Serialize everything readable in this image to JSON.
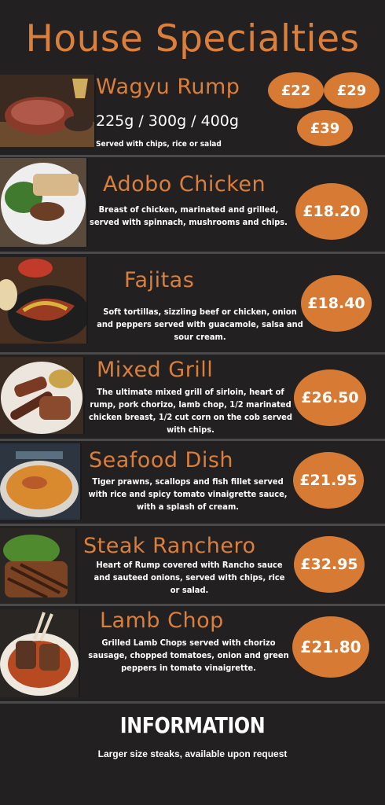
{
  "title": "House Specialties",
  "dishes": [
    {
      "name": "Wagyu Rump",
      "sizes": "225g  / 300g  / 400g",
      "description": "Served with chips, rice or salad",
      "prices": [
        "£22",
        "£29",
        "£39"
      ]
    },
    {
      "name": "Adobo Chicken",
      "description": "Breast of chicken, marinated and grilled, served with spinnach, mushrooms and chips.",
      "price": "£18.20"
    },
    {
      "name": "Fajitas",
      "description": "Soft tortillas, sizzling beef or chicken, onion and peppers served with guacamole, salsa and sour cream.",
      "price": "£18.40"
    },
    {
      "name": "Mixed Grill",
      "description": "The ultimate mixed grill of sirloin, heart of rump, pork chorizo, lamb chop, 1/2 marinated chicken breast, 1/2 cut corn on the cob served with chips.",
      "price": "£26.50"
    },
    {
      "name": "Seafood Dish",
      "description": "Tiger prawns, scallops and fish fillet served with rice and spicy tomato vinaigrette sauce, with a splash of cream.",
      "price": "£21.95"
    },
    {
      "name": "Steak Ranchero",
      "description": "Heart of Rump covered with Rancho sauce and sauteed onions, served with chips, rice or salad.",
      "price": "£32.95"
    },
    {
      "name": "Lamb Chop",
      "description": "Grilled Lamb Chops served with chorizo sausage, chopped tomatoes, onion and green peppers in tomato vinaigrette.",
      "price": "£21.80"
    }
  ],
  "info": {
    "title": "INFORMATION",
    "text": "Larger size steaks, available upon request"
  },
  "colors": {
    "accent": "#db7f3b",
    "price_badge": "#d67a34",
    "background": "#222021"
  }
}
